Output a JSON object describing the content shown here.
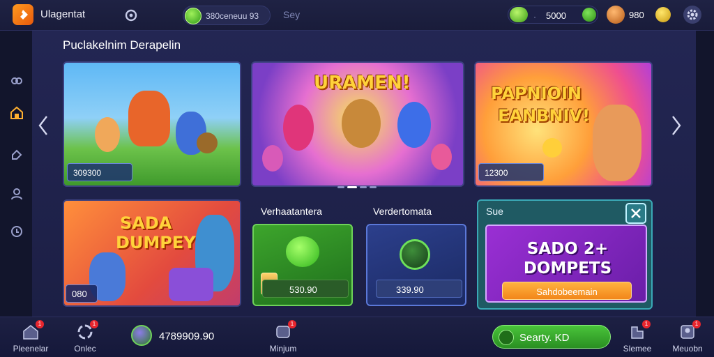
{
  "header": {
    "app_name": "Ulagentat",
    "search_value": "380ceneuu 93",
    "search_placeholder": "Sey",
    "balance_separator": "·",
    "balance": "5000",
    "gems": "980"
  },
  "main": {
    "section_title": "Puclakelnim Derapelin",
    "banners": [
      {
        "title": "",
        "label": "309300"
      },
      {
        "title": "URAMEN!",
        "label": ""
      },
      {
        "title_line1": "PAPNIOIN",
        "title_line2": "EANBNIV!",
        "label": "12300"
      }
    ],
    "promo": {
      "title_line1": "SADA",
      "title_line2": "DUMPEY",
      "badge": "080"
    },
    "tiles": [
      {
        "heading": "Verhaatantera",
        "value": "530.90"
      },
      {
        "heading": "Verdertomata",
        "value": "339.90"
      }
    ],
    "offer": {
      "small_label": "Sue",
      "title_line1": "SADO 2+",
      "title_line2": "DOMPETS",
      "cta": "Sahdobeemain"
    }
  },
  "bottom_nav": {
    "items": [
      {
        "label": "Pleenelar",
        "badge": "1"
      },
      {
        "label": "Onlec",
        "badge": "1"
      },
      {
        "label": "Minjum",
        "badge": "1"
      },
      {
        "label": "Slemee",
        "badge": "1"
      },
      {
        "label": "Meuobn",
        "badge": "1"
      }
    ],
    "wallet_amount": "4789909.90",
    "cta_label": "Searty. KD"
  },
  "colors": {
    "accent": "#ff9a1f",
    "success": "#49c43a",
    "offer_purple": "#9a2fd4",
    "badge_red": "#e8262e"
  },
  "icons": [
    "logo-icon",
    "controller-icon",
    "cash-icon",
    "plus-icon",
    "gem-icon",
    "add-gem-icon",
    "gear-icon",
    "link-icon",
    "home-icon",
    "tag-icon",
    "user-icon",
    "support-icon",
    "chevron-left-icon",
    "chevron-right-icon",
    "close-icon",
    "gamepad-icon"
  ]
}
